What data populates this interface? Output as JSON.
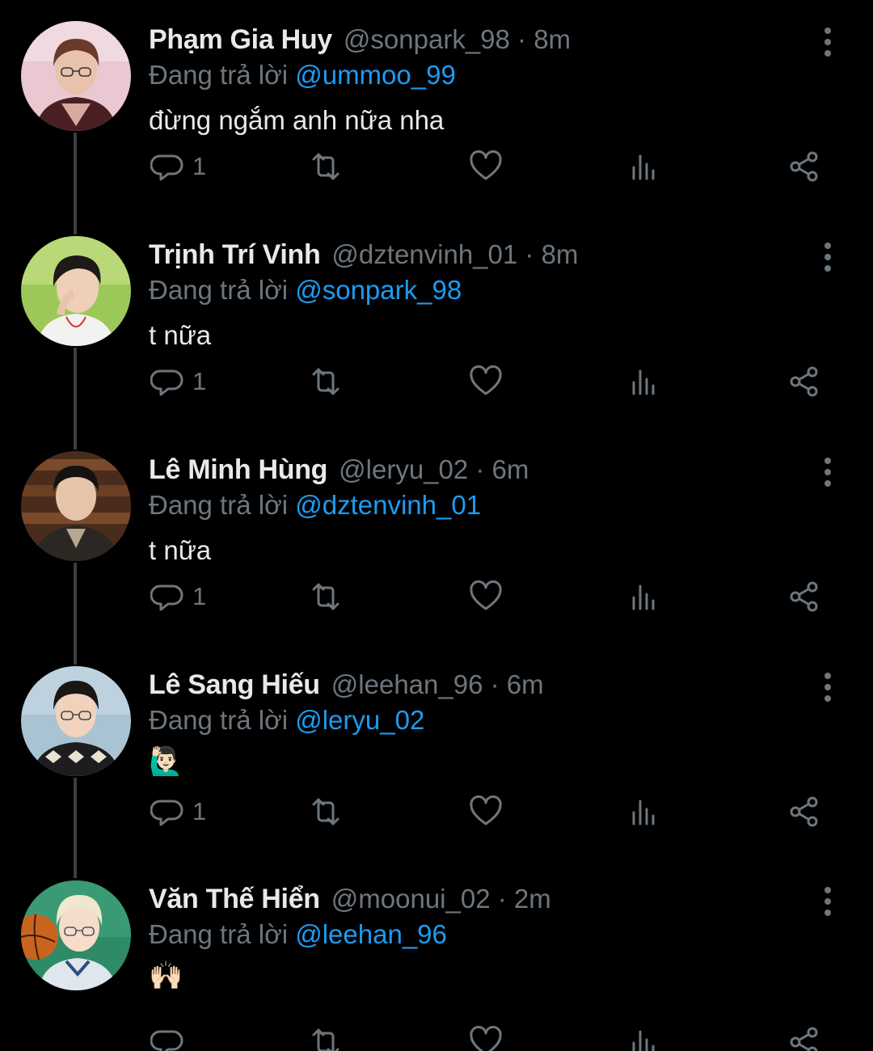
{
  "reply_prefix": "Đang trả lời",
  "colors": {
    "background": "#000000",
    "text": "#e7e9ea",
    "muted": "#6e767d",
    "mention": "#1d9bf0",
    "thread_line": "#3a3e42"
  },
  "icons": {
    "reply": "reply-icon",
    "retweet": "retweet-icon",
    "like": "heart-icon",
    "stats": "stats-icon",
    "share": "share-icon",
    "more": "more-vertical-icon"
  },
  "tweets": [
    {
      "name": "Phạm Gia Huy",
      "handle": "@sonpark_98",
      "time": "8m",
      "handle_time": "@sonpark_98 · 8m",
      "replying_to": "@ummoo_99",
      "text": "đừng ngắm anh nữa nha",
      "reply_count": "1"
    },
    {
      "name": "Trịnh Trí Vinh",
      "handle": "@dztenvinh_01",
      "time": "8m",
      "handle_time": "@dztenvinh_01 · 8m",
      "replying_to": "@sonpark_98",
      "text": "t nữa",
      "reply_count": "1"
    },
    {
      "name": "Lê Minh Hùng",
      "handle": "@leryu_02",
      "time": "6m",
      "handle_time": "@leryu_02 · 6m",
      "replying_to": "@dztenvinh_01",
      "text": "t nữa",
      "reply_count": "1"
    },
    {
      "name": "Lê Sang Hiếu",
      "handle": "@leehan_96",
      "time": "6m",
      "handle_time": "@leehan_96 · 6m",
      "replying_to": "@leryu_02",
      "text": "🙋🏻‍♂️",
      "reply_count": "1"
    },
    {
      "name": "Văn Thế Hiển",
      "handle": "@moonui_02",
      "time": "2m",
      "handle_time": "@moonui_02 · 2m",
      "replying_to": "@leehan_96",
      "text": "🙌🏻",
      "reply_count": ""
    }
  ]
}
